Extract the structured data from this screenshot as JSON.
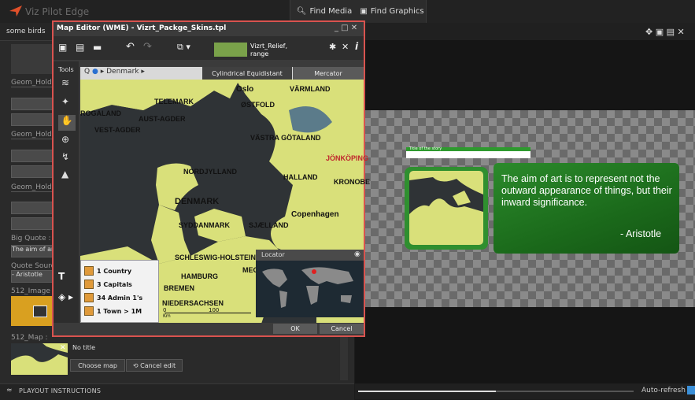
{
  "app": {
    "title": "Viz Pilot Edge"
  },
  "tabs": {
    "find_media": "Find Media",
    "find_graphics": "Find Graphics"
  },
  "left_panel": {
    "doc_title": "some birds",
    "geom_holder_1": "Geom_Holder",
    "geom_holder_2": "Geom_Holder",
    "geom_holder_3": "Geom_Holder",
    "big_quote_label": "Big Quote :",
    "big_quote_value": "The aim of art",
    "quote_source_label": "Quote Source :",
    "quote_source_value": "- Aristotle",
    "image_label": "512_Image :",
    "map_label": "512_Map :",
    "map_title": "No title",
    "choose_map": "Choose map",
    "cancel_edit": "Cancel edit",
    "playout": "PLAYOUT INSTRUCTIONS"
  },
  "editor": {
    "title": "Map Editor (WME)  - Vizrt_Packge_Skins.tpl",
    "window_controls": "_ □ ✕",
    "thumb_label_1": "Vizrt_Relief,",
    "thumb_label_2": "range",
    "tools_label": "Tools",
    "crumb": "Denmark",
    "projection_1": "Cylindrical Equidistant",
    "projection_2": "Mercator",
    "places": {
      "oslo": "Oslo",
      "varmland": "VÄRMLAND",
      "ostfold": "ØSTFOLD",
      "telemark": "TELEMARK",
      "rogaland": "ROGALAND",
      "aust_agder": "AUST-AGDER",
      "vest_agder": "VEST-AGDER",
      "vastra_gotaland": "VÄSTRA GÖTALAND",
      "jonkoping": "JÖNKÖPING",
      "nordjylland": "NORDJYLLAND",
      "halland": "HALLAND",
      "kronoberg": "KRONOBE",
      "denmark": "DENMARK",
      "copenhagen": "Copenhagen",
      "syddanmark": "SYDDANMARK",
      "sjaelland": "SJÆLLAND",
      "schleswig": "SCHLESWIG-HOLSTEIN",
      "meck": "MEC",
      "hamburg": "HAMBURG",
      "bremen": "BREMEN",
      "niedersachsen": "NIEDERSACHSEN"
    },
    "scale_zero": "0",
    "scale_100": "100",
    "scale_unit": "Km",
    "legend": {
      "countries": "1 Country",
      "capitals": "3 Capitals",
      "admins": "34 Admin 1's",
      "towns": "1 Town > 1M"
    },
    "locator_label": "Locator",
    "ok": "OK",
    "cancel": "Cancel"
  },
  "preview": {
    "story_title": "Title of the story",
    "quote": "The aim of art is to represent not the outward appearance of things, but their inward significance.",
    "author": "- Aristotle"
  },
  "bottom": {
    "auto_refresh": "Auto-refresh :"
  },
  "colors": {
    "accent_red": "#d9534f",
    "card_green": "#2e8b2e",
    "land": "#d9e07a",
    "sea": "#2f3336"
  }
}
